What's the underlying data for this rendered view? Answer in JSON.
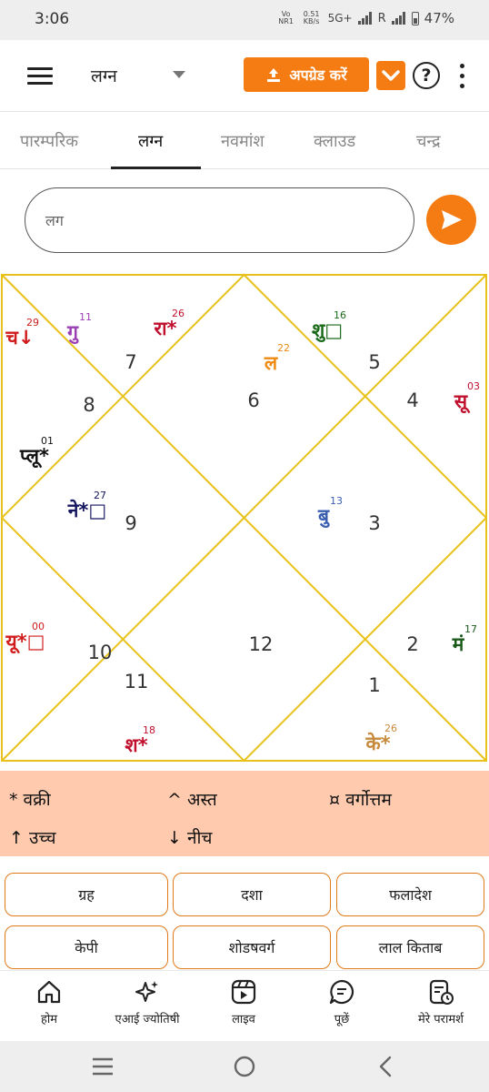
{
  "status": {
    "time": "3:06",
    "net1": "Vo NR1",
    "speed": "0.51",
    "speed_unit": "KB/s",
    "network": "5G+",
    "roaming": "R",
    "battery": "47%"
  },
  "topbar": {
    "chart_select": "लग्न",
    "upgrade_label": "अपग्रेड करें"
  },
  "tabs": [
    "पारम्परिक",
    "लग्न",
    "नवमांश",
    "क्लाउड",
    "चन्द्र"
  ],
  "search": {
    "placeholder": "लग"
  },
  "chart": {
    "line_color": "#e8c21a",
    "houses": [
      "1",
      "2",
      "3",
      "4",
      "5",
      "6",
      "7",
      "8",
      "9",
      "10",
      "11",
      "12"
    ],
    "planets": [
      {
        "glyph": "च",
        "mark": "↓",
        "degree": "29",
        "color": "#d01c1c"
      },
      {
        "glyph": "गु",
        "mark": "",
        "degree": "11",
        "color": "#9b3fb5"
      },
      {
        "glyph": "रा",
        "mark": "*",
        "degree": "26",
        "color": "#c0102e"
      },
      {
        "glyph": "ल",
        "mark": "",
        "degree": "22",
        "color": "#ee8a12"
      },
      {
        "glyph": "शु",
        "mark": "□",
        "degree": "16",
        "color": "#1a6a1a"
      },
      {
        "glyph": "सू",
        "mark": "",
        "degree": "03",
        "color": "#c0102e"
      },
      {
        "glyph": "प्लू",
        "mark": "*",
        "degree": "01",
        "color": "#111111"
      },
      {
        "glyph": "ने",
        "mark": "*□",
        "degree": "27",
        "color": "#151560"
      },
      {
        "glyph": "बु",
        "mark": "",
        "degree": "13",
        "color": "#3b5fb0"
      },
      {
        "glyph": "यू",
        "mark": "*□",
        "degree": "00",
        "color": "#d01c1c"
      },
      {
        "glyph": "मं",
        "mark": "",
        "degree": "17",
        "color": "#1a5a1a"
      },
      {
        "glyph": "श",
        "mark": "*",
        "degree": "18",
        "color": "#c0102e"
      },
      {
        "glyph": "के",
        "mark": "*",
        "degree": "26",
        "color": "#c78a3c"
      }
    ]
  },
  "legend": {
    "retro": "* वक्री",
    "combust": "^ अस्त",
    "vargottam": "¤ वर्गोत्तम",
    "exalted": "↑ उच्च",
    "debilitated": "↓ नीच"
  },
  "buttons": [
    "ग्रह",
    "दशा",
    "फलादेश",
    "केपी",
    "शोडषवर्ग",
    "लाल किताब"
  ],
  "bottom_nav": [
    "होम",
    "एआई ज्योतिषी",
    "लाइव",
    "पूछें",
    "मेरे परामर्श"
  ],
  "colors": {
    "accent": "#f57c12",
    "legend_bg": "#ffcaae",
    "button_border": "#e0791a"
  }
}
